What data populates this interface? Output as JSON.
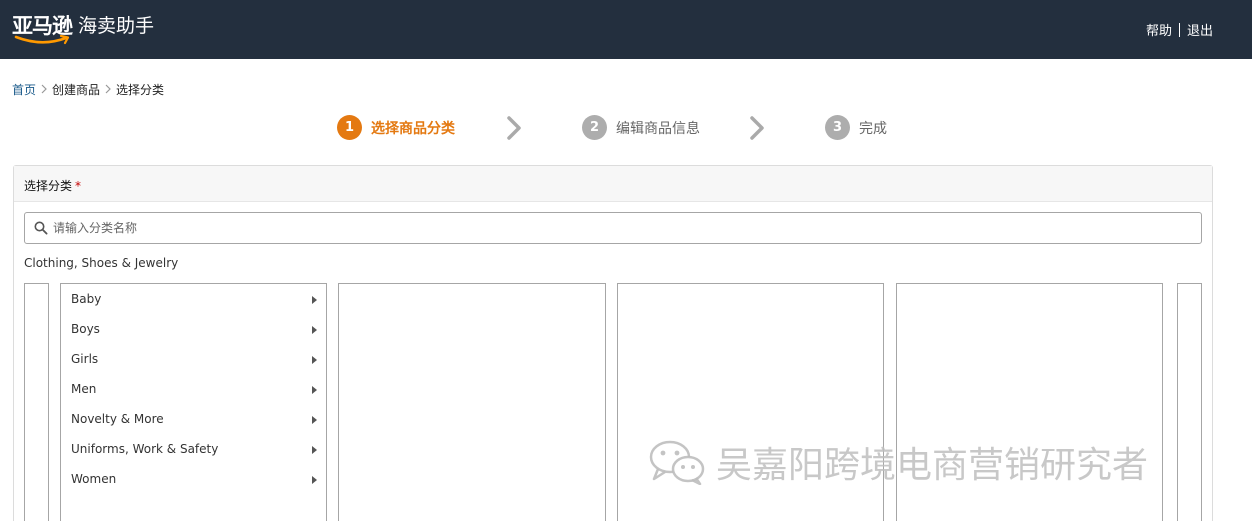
{
  "header": {
    "logo_main": "亚马逊",
    "logo_sub": "海卖助手",
    "links": [
      "帮助",
      "退出"
    ]
  },
  "breadcrumb": [
    "首页",
    "创建商品",
    "选择分类"
  ],
  "steps": [
    {
      "num": "1",
      "label": "选择商品分类",
      "active": true
    },
    {
      "num": "2",
      "label": "编辑商品信息",
      "active": false
    },
    {
      "num": "3",
      "label": "完成",
      "active": false
    }
  ],
  "panel": {
    "title": "选择分类",
    "required_mark": "*",
    "search_placeholder": "请输入分类名称",
    "category_path": "Clothing, Shoes & Jewelry",
    "categories": [
      "Baby",
      "Boys",
      "Girls",
      "Men",
      "Novelty & More",
      "Uniforms, Work & Safety",
      "Women"
    ]
  },
  "watermark": {
    "text": "吴嘉阳跨境电商营销研究者",
    "icon": "wechat-icon"
  },
  "colors": {
    "topbar": "#232f3e",
    "accent_orange": "#e47911",
    "step_inactive": "#adadad",
    "link_blue": "#1a5a8a"
  }
}
